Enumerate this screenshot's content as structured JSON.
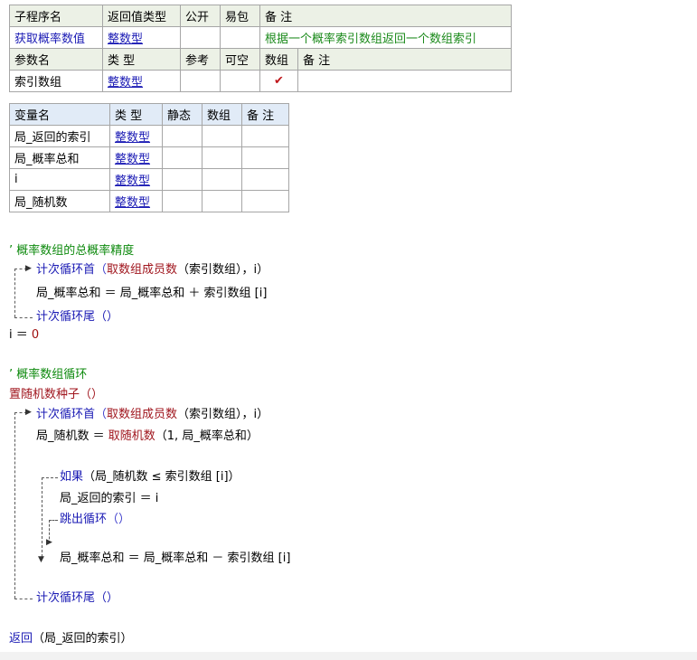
{
  "subroutine_table": {
    "headers": [
      "子程序名",
      "返回值类型",
      "公开",
      "易包",
      "备 注"
    ],
    "name": "获取概率数值",
    "return_type": "整数型",
    "public": "",
    "easy_pack": "",
    "remark": "根据一个概率索引数组返回一个数组索引",
    "param_headers": [
      "参数名",
      "类 型",
      "参考",
      "可空",
      "数组",
      "备 注"
    ],
    "params": [
      {
        "name": "索引数组",
        "type": "整数型",
        "ref": "",
        "nullable": "",
        "array": "✔",
        "remark": ""
      }
    ]
  },
  "variable_table": {
    "headers": [
      "变量名",
      "类 型",
      "静态",
      "数组",
      "备 注"
    ],
    "rows": [
      {
        "name": "局_返回的索引",
        "type": "整数型"
      },
      {
        "name": "局_概率总和",
        "type": "整数型"
      },
      {
        "name": "i",
        "type": "整数型"
      },
      {
        "name": "局_随机数",
        "type": "整数型"
      }
    ]
  },
  "code": {
    "comment1": "’ 概率数组的总概率精度",
    "loop1_head_kw": "计次循环首",
    "loop1_head_fn": "取数组成员数",
    "loop1_head_args": "（索引数组），i）",
    "loop1_open": "（",
    "line_sum_add": "局_概率总和 ＝ 局_概率总和 ＋ 索引数组 [i]",
    "loop1_tail": "计次循环尾（）",
    "assign_i": "i ＝ ",
    "assign_i_value": "0",
    "comment2": "’ 概率数组循环",
    "seed": "置随机数种子（）",
    "loop2_head_kw": "计次循环首",
    "loop2_head_fn": "取数组成员数",
    "loop2_head_args": "（索引数组），i）",
    "loop2_open": "（",
    "rand_lhs": "局_随机数 ＝ ",
    "rand_fn": "取随机数",
    "rand_args": "（1, 局_概率总和）",
    "if_kw": "如果",
    "if_cond": "（局_随机数 ≤ 索引数组 [i]）",
    "set_index": "局_返回的索引 ＝ i",
    "break_kw": "跳出循环",
    "break_args": "（）",
    "line_sum_sub": "局_概率总和 ＝ 局_概率总和 － 索引数组 [i]",
    "loop2_tail": "计次循环尾（）",
    "return_kw": "返回",
    "return_args": "（局_返回的索引）"
  }
}
